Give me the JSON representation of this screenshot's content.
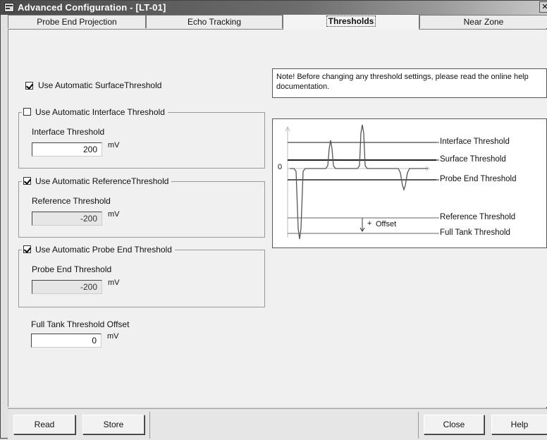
{
  "window": {
    "title": "Advanced Configuration - [LT-01]",
    "close_glyph": "✕"
  },
  "tabs": [
    {
      "label": "Probe End Projection"
    },
    {
      "label": "Echo Tracking"
    },
    {
      "label": "Thresholds",
      "active": true
    },
    {
      "label": "Near Zone"
    }
  ],
  "thresholds": {
    "surface": {
      "label": "Use Automatic SurfaceThreshold",
      "checked": true
    },
    "interface": {
      "group_label": "Use Automatic Interface Threshold",
      "checked": false,
      "field_label": "Interface Threshold",
      "value": "200",
      "unit": "mV",
      "enabled": true
    },
    "reference": {
      "group_label": "Use Automatic ReferenceThreshold",
      "checked": true,
      "field_label": "Reference Threshold",
      "value": "-200",
      "unit": "mV",
      "enabled": false
    },
    "probe_end": {
      "group_label": "Use Automatic Probe End Threshold",
      "checked": true,
      "field_label": "Probe End Threshold",
      "value": "-200",
      "unit": "mV",
      "enabled": false
    },
    "full_tank": {
      "field_label": "Full Tank Threshold Offset",
      "value": "0",
      "unit": "mV"
    }
  },
  "note": {
    "text": "Note! Before changing any threshold settings, please read the online help documentation."
  },
  "diagram": {
    "zero_label": "0",
    "offset_label": "Offset",
    "offset_sign": "+",
    "lines": [
      {
        "label": "Interface Threshold"
      },
      {
        "label": "Surface Threshold"
      },
      {
        "label": "Probe End Threshold"
      },
      {
        "label": "Reference Threshold"
      },
      {
        "label": "Full Tank Threshold"
      }
    ]
  },
  "buttons": {
    "read": "Read",
    "store": "Store",
    "close": "Close",
    "help": "Help"
  }
}
